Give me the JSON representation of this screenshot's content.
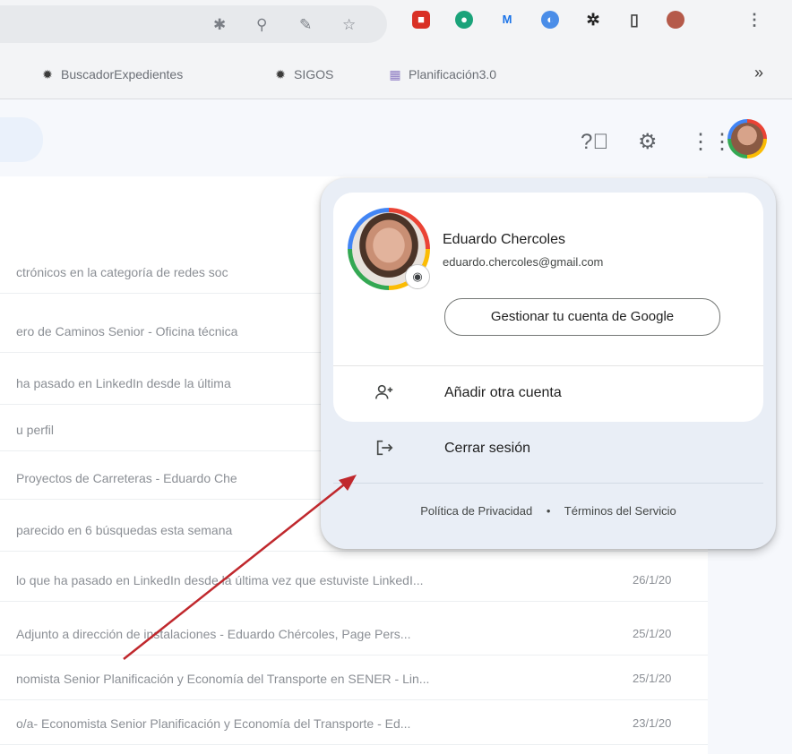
{
  "browser": {
    "bookmarks": [
      {
        "label": "BuscadorExpedientes",
        "icon": "gear-icon"
      },
      {
        "label": "SIGOS",
        "icon": "gear-icon"
      },
      {
        "label": "Planificación3.0",
        "icon": "chart-icon"
      }
    ],
    "bookmarks_more": "»"
  },
  "mail_rows": [
    {
      "subject": "ctrónicos en la categoría de redes soc",
      "date": ""
    },
    {
      "subject": "ero de Caminos Senior - Oficina técnica",
      "date": ""
    },
    {
      "subject": "ha pasado en LinkedIn desde la última",
      "date": ""
    },
    {
      "subject": "u perfil",
      "date": ""
    },
    {
      "subject": "Proyectos de Carreteras - Eduardo Che",
      "date": ""
    },
    {
      "subject": "parecido en 6 búsquedas esta semana",
      "date": ""
    },
    {
      "subject": "lo que ha pasado en LinkedIn desde la última vez que estuviste LinkedI...",
      "date": "26/1/20"
    },
    {
      "subject": "Adjunto a dirección de instalaciones - Eduardo Chércoles, Page Pers...",
      "date": "25/1/20"
    },
    {
      "subject": "nomista Senior Planificación y Economía del Transporte en SENER - Lin...",
      "date": "25/1/20"
    },
    {
      "subject": "o/a- Economista Senior Planificación y Economía del Transporte - Ed...",
      "date": "23/1/20"
    }
  ],
  "account_popup": {
    "name": "Eduardo Chercoles",
    "email": "eduardo.chercoles@gmail.com",
    "manage_label": "Gestionar tu cuenta de Google",
    "add_account_label": "Añadir otra cuenta",
    "logout_label": "Cerrar sesión",
    "privacy_label": "Política de Privacidad",
    "separator": "•",
    "terms_label": "Términos del Servicio"
  },
  "colors": {
    "google_red": "#ea4335",
    "google_yellow": "#fbbc04",
    "google_green": "#34a853",
    "google_blue": "#4285f4",
    "annotation_arrow": "#c0282d"
  }
}
